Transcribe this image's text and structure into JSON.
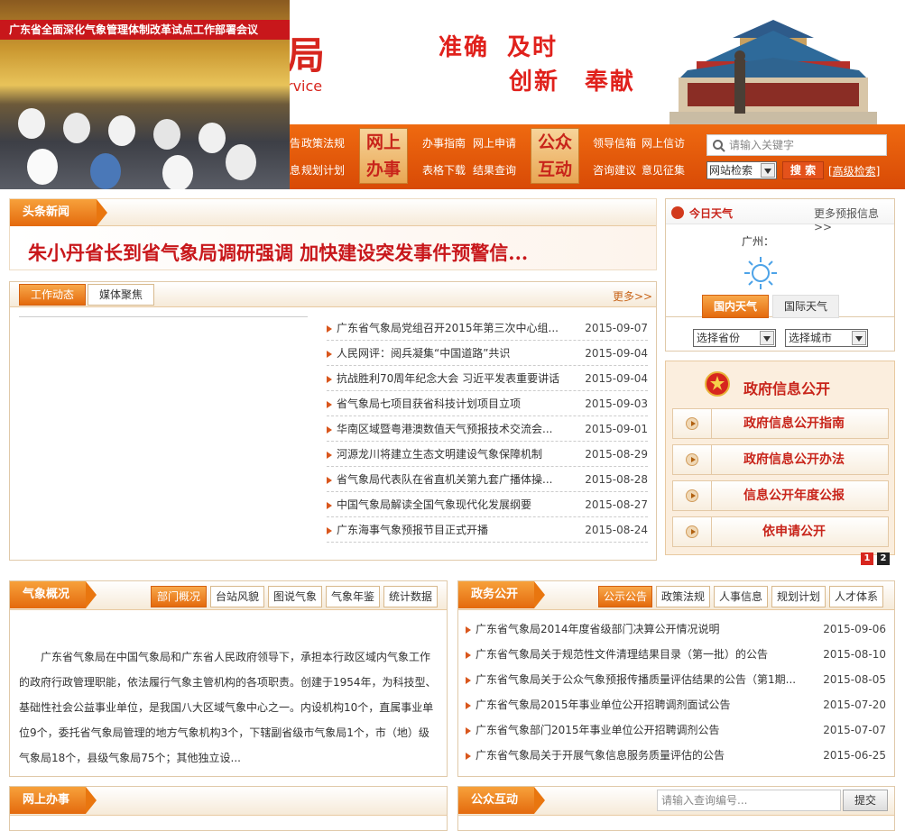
{
  "banner": {
    "photo_caption": "广东省全面深化气象管理体制改革试点工作部署会议",
    "logo_char": "局",
    "logo_en": "rvice",
    "slogan": [
      "准确",
      "及时",
      "创新",
      "奉献"
    ]
  },
  "nav": {
    "left_row1": [
      "告",
      "政策法规"
    ],
    "left_row2": [
      "息",
      "规划计划"
    ],
    "box1": [
      "网上",
      "办事"
    ],
    "box1_row1": [
      "办事指南",
      "网上申请"
    ],
    "box1_row2": [
      "表格下载",
      "结果查询"
    ],
    "box2": [
      "公众",
      "互动"
    ],
    "box2_row1": [
      "领导信箱",
      "网上信访"
    ],
    "box2_row2": [
      "咨询建议",
      "意见征集"
    ]
  },
  "search": {
    "placeholder": "请输入关键字",
    "scope": "网站检索",
    "button": "搜 索",
    "advanced": "[高级检索]"
  },
  "headline": {
    "tab": "头条新闻",
    "title": "朱小丹省长到省气象局调研强调 加快建设突发事件预警信..."
  },
  "work_news": {
    "tabs": [
      "工作动态",
      "媒体聚焦"
    ],
    "more": "更多>>",
    "items": [
      {
        "title": "广东省气象局党组召开2015年第三次中心组...",
        "date": "2015-09-07"
      },
      {
        "title": "人民网评：阅兵凝集“中国道路”共识",
        "date": "2015-09-04"
      },
      {
        "title": "抗战胜利70周年纪念大会 习近平发表重要讲话",
        "date": "2015-09-04"
      },
      {
        "title": "省气象局七项目获省科技计划项目立项",
        "date": "2015-09-03"
      },
      {
        "title": "华南区域暨粤港澳数值天气预报技术交流会...",
        "date": "2015-09-01"
      },
      {
        "title": "河源龙川将建立生态文明建设气象保障机制",
        "date": "2015-08-29"
      },
      {
        "title": "省气象局代表队在省直机关第九套广播体操...",
        "date": "2015-08-28"
      },
      {
        "title": "中国气象局解读全国气象现代化发展纲要",
        "date": "2015-08-27"
      },
      {
        "title": "广东海事气象预报节目正式开播",
        "date": "2015-08-24"
      }
    ]
  },
  "weather": {
    "title": "今日天气",
    "more": "更多预报信息>>",
    "city": "广州：",
    "tabs": [
      "国内天气",
      "国际天气"
    ],
    "province_select": "选择省份",
    "city_select": "选择城市"
  },
  "gov_info": {
    "title": "政府信息公开",
    "buttons": [
      "政府信息公开指南",
      "政府信息公开办法",
      "信息公开年度公报",
      "依申请公开"
    ],
    "pages": [
      "1",
      "2"
    ]
  },
  "overview": {
    "tab": "气象概况",
    "subtabs": [
      "部门概况",
      "台站风貌",
      "图说气象",
      "气象年鉴",
      "统计数据"
    ],
    "lines": [
      "广东省气象局在中国气象局和广东省人民政府领导下，承担本行政区域内气象工作",
      "的政府行政管理职能，依法履行气象主管机构的各项职责。创建于1954年，为科技型、",
      "基础性社会公益事业单位，是我国八大区域气象中心之一。内设机构10个，直属事业单",
      "位9个，委托省气象局管理的地方气象机构3个，下辖副省级市气象局1个，市（地）级",
      "气象局18个，县级气象局75个；其他独立设..."
    ]
  },
  "affairs": {
    "tab": "政务公开",
    "subtabs": [
      "公示公告",
      "政策法规",
      "人事信息",
      "规划计划",
      "人才体系"
    ],
    "items": [
      {
        "title": "广东省气象局2014年度省级部门决算公开情况说明",
        "date": "2015-09-06"
      },
      {
        "title": "广东省气象局关于规范性文件清理结果目录（第一批）的公告",
        "date": "2015-08-10"
      },
      {
        "title": "广东省气象局关于公众气象预报传播质量评估结果的公告（第1期...",
        "date": "2015-08-05"
      },
      {
        "title": "广东省气象局2015年事业单位公开招聘调剂面试公告",
        "date": "2015-07-20"
      },
      {
        "title": "广东省气象部门2015年事业单位公开招聘调剂公告",
        "date": "2015-07-07"
      },
      {
        "title": "广东省气象局关于开展气象信息服务质量评估的公告",
        "date": "2015-06-25"
      }
    ]
  },
  "online": {
    "tab": "网上办事"
  },
  "public": {
    "tab": "公众互动",
    "placeholder": "请输入查询编号...",
    "button": "提交"
  }
}
